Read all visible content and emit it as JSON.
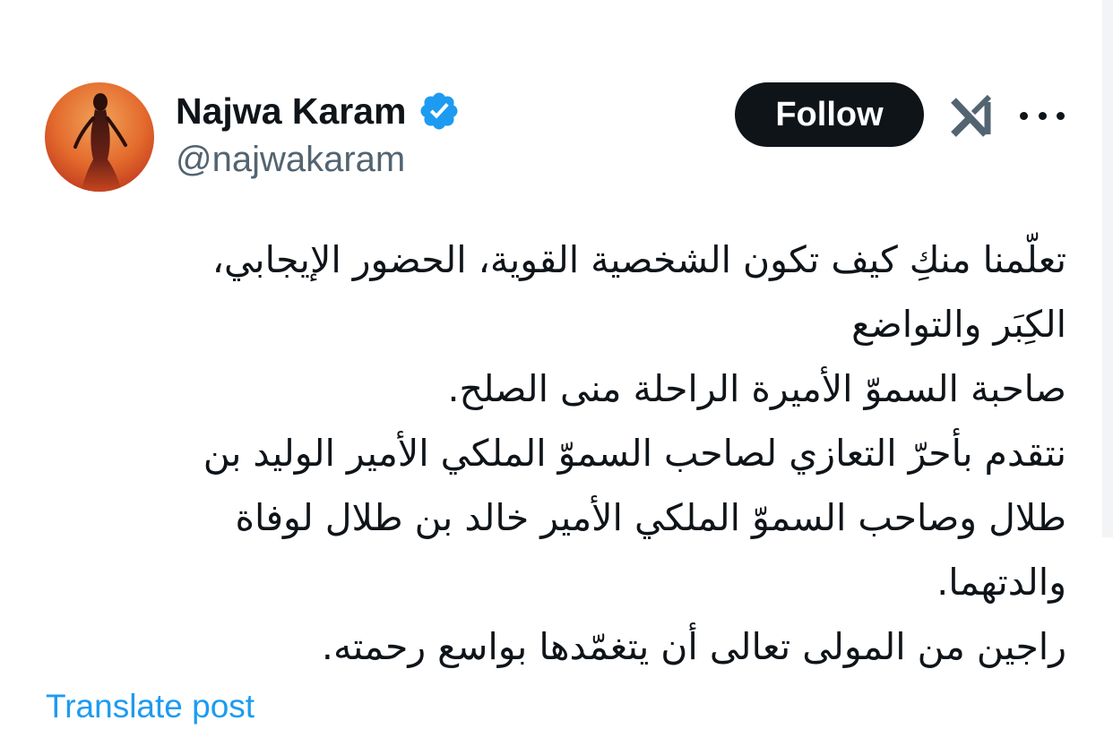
{
  "tweet": {
    "author": {
      "display_name": "Najwa Karam",
      "handle": "@najwakaram",
      "verified_icon": "verified-badge-icon",
      "avatar_icon": "profile-photo"
    },
    "actions": {
      "follow_label": "Follow",
      "grok_icon": "grok-icon",
      "more_icon": "more-options-icon"
    },
    "text_lines": [
      "تعلّمنا منكِ كيف تكون الشخصية القوية، الحضور الإيجابي،",
      "الكِبَر والتواضع",
      "صاحبة السموّ الأميرة الراحلة منى الصلح.",
      "نتقدم بأحرّ التعازي لصاحب السموّ الملكي الأمير الوليد بن",
      "طلال وصاحب السموّ الملكي الأمير خالد بن طلال لوفاة",
      "والدتهما.",
      "راجين من المولى تعالى أن يتغمّدها بواسع رحمته."
    ],
    "translate_label": "Translate post"
  },
  "colors": {
    "text_primary": "#0f1419",
    "text_secondary": "#536471",
    "link": "#1d9bf0",
    "verified": "#1d9bf0",
    "follow_bg": "#0f1419",
    "follow_text": "#ffffff"
  }
}
